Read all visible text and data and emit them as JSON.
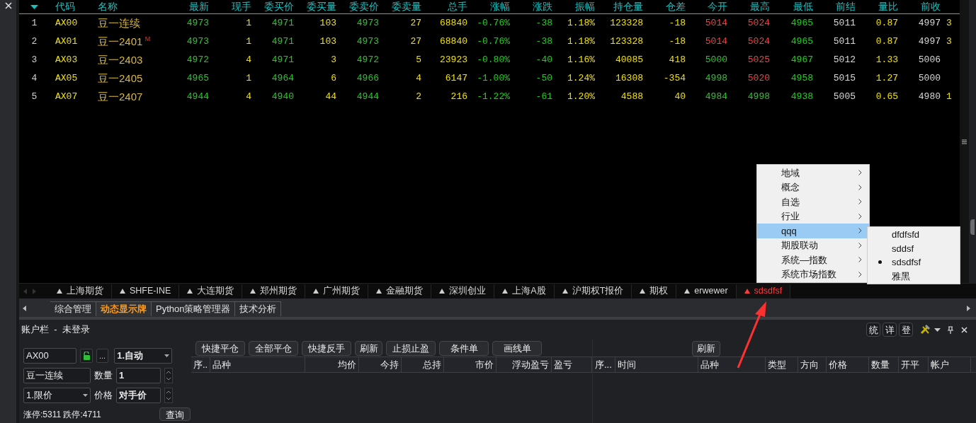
{
  "quote_table": {
    "columns": [
      {
        "kind": "index"
      },
      {
        "label": "代码",
        "kind": "text"
      },
      {
        "label": "名称",
        "kind": "name"
      },
      {
        "label": "最新",
        "kind": "number"
      },
      {
        "label": "现手",
        "kind": "number"
      },
      {
        "label": "委买价",
        "kind": "number"
      },
      {
        "label": "委买量",
        "kind": "number"
      },
      {
        "label": "委卖价",
        "kind": "number"
      },
      {
        "label": "委卖量",
        "kind": "number"
      },
      {
        "label": "总手",
        "kind": "number"
      },
      {
        "label": "涨幅",
        "kind": "number"
      },
      {
        "label": "涨跌",
        "kind": "number"
      },
      {
        "label": "振幅",
        "kind": "number"
      },
      {
        "label": "持仓量",
        "kind": "number"
      },
      {
        "label": "仓差",
        "kind": "number"
      },
      {
        "label": "今开",
        "kind": "number"
      },
      {
        "label": "最高",
        "kind": "number"
      },
      {
        "label": "最低",
        "kind": "number"
      },
      {
        "label": "前结",
        "kind": "number"
      },
      {
        "label": "量比",
        "kind": "number"
      },
      {
        "label": "前收",
        "kind": "number"
      },
      {
        "kind": "cut"
      }
    ],
    "rows": [
      {
        "cells": [
          {
            "text": "1",
            "color": "#d0d0d0"
          },
          {
            "text": "AX00",
            "color": "#f0e000"
          },
          {
            "text": "豆一连续",
            "color": "#d8b838"
          },
          {
            "text": "4973",
            "color": "#22cc22"
          },
          {
            "text": "1",
            "color": "#f0e000"
          },
          {
            "text": "4971",
            "color": "#22cc22"
          },
          {
            "text": "103",
            "color": "#f0e000"
          },
          {
            "text": "4973",
            "color": "#22cc22"
          },
          {
            "text": "27",
            "color": "#f0e000"
          },
          {
            "text": "68840",
            "color": "#f0e000"
          },
          {
            "text": "-0.76%",
            "color": "#22cc22"
          },
          {
            "text": "-38",
            "color": "#22cc22"
          },
          {
            "text": "1.18%",
            "color": "#f0e000"
          },
          {
            "text": "123328",
            "color": "#f0e000"
          },
          {
            "text": "-18",
            "color": "#f0e000"
          },
          {
            "text": "5014",
            "color": "#ff3c3c"
          },
          {
            "text": "5024",
            "color": "#ff3c3c"
          },
          {
            "text": "4965",
            "color": "#22cc22"
          },
          {
            "text": "5011",
            "color": "#d8d8d8"
          },
          {
            "text": "0.87",
            "color": "#f0e000"
          },
          {
            "text": "4997",
            "color": "#d8d8d8"
          },
          {
            "text": "3",
            "color": "#f0e000"
          }
        ]
      },
      {
        "flag": "M",
        "cells": [
          {
            "text": "2",
            "color": "#d0d0d0"
          },
          {
            "text": "AX01",
            "color": "#f0e000"
          },
          {
            "text": "豆一2401",
            "color": "#d8b838"
          },
          {
            "text": "4973",
            "color": "#22cc22"
          },
          {
            "text": "1",
            "color": "#f0e000"
          },
          {
            "text": "4971",
            "color": "#22cc22"
          },
          {
            "text": "103",
            "color": "#f0e000"
          },
          {
            "text": "4973",
            "color": "#22cc22"
          },
          {
            "text": "27",
            "color": "#f0e000"
          },
          {
            "text": "68840",
            "color": "#f0e000"
          },
          {
            "text": "-0.76%",
            "color": "#22cc22"
          },
          {
            "text": "-38",
            "color": "#22cc22"
          },
          {
            "text": "1.18%",
            "color": "#f0e000"
          },
          {
            "text": "123328",
            "color": "#f0e000"
          },
          {
            "text": "-18",
            "color": "#f0e000"
          },
          {
            "text": "5014",
            "color": "#ff3c3c"
          },
          {
            "text": "5024",
            "color": "#ff3c3c"
          },
          {
            "text": "4965",
            "color": "#22cc22"
          },
          {
            "text": "5011",
            "color": "#d8d8d8"
          },
          {
            "text": "0.87",
            "color": "#f0e000"
          },
          {
            "text": "4997",
            "color": "#d8d8d8"
          },
          {
            "text": "3",
            "color": "#f0e000"
          }
        ]
      },
      {
        "cells": [
          {
            "text": "3",
            "color": "#d0d0d0"
          },
          {
            "text": "AX03",
            "color": "#f0e000"
          },
          {
            "text": "豆一2403",
            "color": "#d8b838"
          },
          {
            "text": "4972",
            "color": "#22cc22"
          },
          {
            "text": "4",
            "color": "#f0e000"
          },
          {
            "text": "4971",
            "color": "#22cc22"
          },
          {
            "text": "3",
            "color": "#f0e000"
          },
          {
            "text": "4972",
            "color": "#22cc22"
          },
          {
            "text": "5",
            "color": "#f0e000"
          },
          {
            "text": "23923",
            "color": "#f0e000"
          },
          {
            "text": "-0.80%",
            "color": "#22cc22"
          },
          {
            "text": "-40",
            "color": "#22cc22"
          },
          {
            "text": "1.16%",
            "color": "#f0e000"
          },
          {
            "text": "40085",
            "color": "#f0e000"
          },
          {
            "text": "418",
            "color": "#f0e000"
          },
          {
            "text": "5000",
            "color": "#22cc22"
          },
          {
            "text": "5025",
            "color": "#ff3c3c"
          },
          {
            "text": "4967",
            "color": "#22cc22"
          },
          {
            "text": "5012",
            "color": "#d8d8d8"
          },
          {
            "text": "1.33",
            "color": "#f0e000"
          },
          {
            "text": "5006",
            "color": "#d8d8d8"
          }
        ]
      },
      {
        "cells": [
          {
            "text": "4",
            "color": "#d0d0d0"
          },
          {
            "text": "AX05",
            "color": "#f0e000"
          },
          {
            "text": "豆一2405",
            "color": "#d8b838"
          },
          {
            "text": "4965",
            "color": "#22cc22"
          },
          {
            "text": "1",
            "color": "#f0e000"
          },
          {
            "text": "4964",
            "color": "#22cc22"
          },
          {
            "text": "6",
            "color": "#f0e000"
          },
          {
            "text": "4966",
            "color": "#22cc22"
          },
          {
            "text": "4",
            "color": "#f0e000"
          },
          {
            "text": "6147",
            "color": "#f0e000"
          },
          {
            "text": "-1.00%",
            "color": "#22cc22"
          },
          {
            "text": "-50",
            "color": "#22cc22"
          },
          {
            "text": "1.24%",
            "color": "#f0e000"
          },
          {
            "text": "16308",
            "color": "#f0e000"
          },
          {
            "text": "-354",
            "color": "#f0e000"
          },
          {
            "text": "4998",
            "color": "#22cc22"
          },
          {
            "text": "5020",
            "color": "#ff3c3c"
          },
          {
            "text": "4958",
            "color": "#22cc22"
          },
          {
            "text": "5015",
            "color": "#d8d8d8"
          },
          {
            "text": "1.27",
            "color": "#f0e000"
          },
          {
            "text": "5000",
            "color": "#d8d8d8"
          }
        ]
      },
      {
        "cells": [
          {
            "text": "5",
            "color": "#d0d0d0"
          },
          {
            "text": "AX07",
            "color": "#f0e000"
          },
          {
            "text": "豆一2407",
            "color": "#d8b838"
          },
          {
            "text": "4944",
            "color": "#22cc22"
          },
          {
            "text": "4",
            "color": "#f0e000"
          },
          {
            "text": "4940",
            "color": "#22cc22"
          },
          {
            "text": "44",
            "color": "#f0e000"
          },
          {
            "text": "4944",
            "color": "#22cc22"
          },
          {
            "text": "2",
            "color": "#f0e000"
          },
          {
            "text": "216",
            "color": "#f0e000"
          },
          {
            "text": "-1.22%",
            "color": "#22cc22"
          },
          {
            "text": "-61",
            "color": "#22cc22"
          },
          {
            "text": "1.20%",
            "color": "#f0e000"
          },
          {
            "text": "4588",
            "color": "#f0e000"
          },
          {
            "text": "40",
            "color": "#f0e000"
          },
          {
            "text": "4984",
            "color": "#22cc22"
          },
          {
            "text": "4998",
            "color": "#22cc22"
          },
          {
            "text": "4938",
            "color": "#22cc22"
          },
          {
            "text": "5005",
            "color": "#d8d8d8"
          },
          {
            "text": "0.65",
            "color": "#f0e000"
          },
          {
            "text": "4980",
            "color": "#d8d8d8"
          },
          {
            "text": "1",
            "color": "#f0e000"
          }
        ]
      }
    ]
  },
  "market_tabs": [
    {
      "label": "上海期货",
      "selected": false
    },
    {
      "label": "SHFE-INE",
      "selected": false
    },
    {
      "label": "大连期货",
      "selected": false
    },
    {
      "label": "郑州期货",
      "selected": false
    },
    {
      "label": "广州期货",
      "selected": false
    },
    {
      "label": "金融期货",
      "selected": false
    },
    {
      "label": "深圳创业",
      "selected": false
    },
    {
      "label": "上海A股",
      "selected": false
    },
    {
      "label": "沪期权T报价",
      "selected": false
    },
    {
      "label": "期权",
      "selected": false
    },
    {
      "label": "erwewer",
      "selected": false
    },
    {
      "label": "sdsdfsf",
      "selected": true
    }
  ],
  "workspace_tabs": [
    {
      "label": "综合管理",
      "selected": false
    },
    {
      "label": "动态显示牌",
      "selected": true
    },
    {
      "label": "Python策略管理器",
      "selected": false
    },
    {
      "label": "技术分析",
      "selected": false
    }
  ],
  "context_menu": {
    "items": [
      {
        "label": "地域",
        "selected": false
      },
      {
        "label": "概念",
        "selected": false
      },
      {
        "label": "自选",
        "selected": false
      },
      {
        "label": "行业",
        "selected": false
      },
      {
        "label": "qqq",
        "selected": true
      },
      {
        "label": "期股联动",
        "selected": false
      },
      {
        "label": "系统—指数",
        "selected": false
      },
      {
        "label": "系统市场指数",
        "selected": false
      }
    ],
    "submenu": [
      {
        "label": "dfdfsfd",
        "checked": false
      },
      {
        "label": "sddsf",
        "checked": false
      },
      {
        "label": "sdsdfsf",
        "checked": true
      },
      {
        "label": "雅黑",
        "checked": false
      }
    ]
  },
  "account_panel": {
    "title": "账户栏  -  未登录",
    "header_buttons": [
      "统",
      "详",
      "登"
    ],
    "order_form": {
      "code": "AX00",
      "more": "...",
      "mode": "1.自动",
      "name": "豆一连续",
      "qty_label": "数量",
      "qty": "1",
      "price_type": "1.限价",
      "price_label": "价格",
      "price": "对手价",
      "limits": "涨停:5311 跌停:4711",
      "query": "查询"
    },
    "position_buttons": [
      "快捷平仓",
      "全部平仓",
      "快捷反手",
      "刷新",
      "止损止盈",
      "条件单",
      "画线单"
    ],
    "position_columns": [
      "序..",
      "品种",
      "均价",
      "今持",
      "总持",
      "市价",
      "浮动盈亏",
      "盈亏"
    ],
    "order_refresh": "刷新",
    "order_columns": [
      "序...",
      "时间",
      "品种",
      "类型",
      "方向",
      "价格",
      "数量",
      "开平",
      "帐户"
    ]
  }
}
